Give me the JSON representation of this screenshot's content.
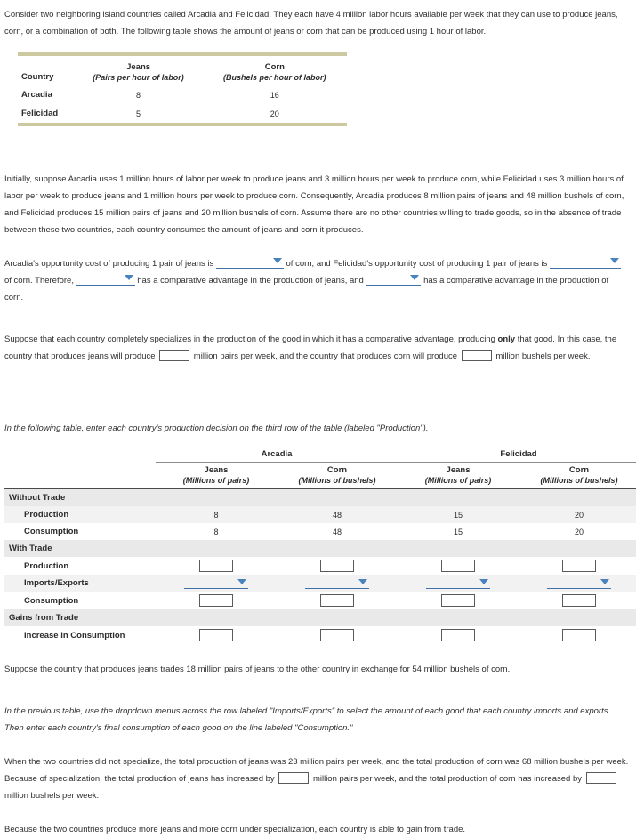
{
  "intro": {
    "paragraph": "Consider two neighboring island countries called Arcadia and Felicidad. They each have 4 million labor hours available per week that they can use to produce jeans, corn, or a combination of both. The following table shows the amount of jeans or corn that can be produced using 1 hour of labor."
  },
  "productivity_table": {
    "header_country": "Country",
    "goods": [
      {
        "name": "Jeans",
        "unit": "(Pairs per hour of labor)"
      },
      {
        "name": "Corn",
        "unit": "(Bushels per hour of labor)"
      }
    ],
    "rows": [
      {
        "country": "Arcadia",
        "jeans": "8",
        "corn": "16"
      },
      {
        "country": "Felicidad",
        "jeans": "5",
        "corn": "20"
      }
    ]
  },
  "initial": {
    "paragraph": "Initially, suppose Arcadia uses 1 million hours of labor per week to produce jeans and 3 million hours per week to produce corn, while Felicidad uses 3 million hours of labor per week to produce jeans and 1 million hours per week to produce corn. Consequently, Arcadia produces 8 million pairs of jeans and 48 million bushels of corn, and Felicidad produces 15 million pairs of jeans and 20 million bushels of corn. Assume there are no other countries willing to trade goods, so in the absence of trade between these two countries, each country consumes the amount of jeans and corn it produces."
  },
  "opportunity_cost": {
    "seg1": "Arcadia's opportunity cost of producing 1 pair of jeans is",
    "seg2": "of corn, and Felicidad's opportunity cost of producing 1 pair of jeans is",
    "seg3": "of corn. Therefore,",
    "seg4": "has a comparative advantage in the production of jeans, and",
    "seg5": "has a comparative advantage in the production of corn.",
    "dropdown_value": ""
  },
  "specialization": {
    "seg1": "Suppose that each country completely specializes in the production of the good in which it has a comparative advantage, producing",
    "emphasis": "only",
    "seg2": "that good. In this case, the country that produces jeans will produce",
    "seg3": "million pairs per week, and the country that produces corn will produce",
    "seg4": "million bushels per week.",
    "input_value": ""
  },
  "table_instruction": "In the following table, enter each country's production decision on the third row of the table (labeled \"Production\").",
  "trade_table": {
    "countries": [
      {
        "name": "Arcadia",
        "columns": [
          {
            "good": "Jeans",
            "unit": "(Millions of pairs)"
          },
          {
            "good": "Corn",
            "unit": "(Millions of bushels)"
          }
        ]
      },
      {
        "name": "Felicidad",
        "columns": [
          {
            "good": "Jeans",
            "unit": "(Millions of pairs)"
          },
          {
            "good": "Corn",
            "unit": "(Millions of bushels)"
          }
        ]
      }
    ],
    "sections": [
      {
        "title": "Without Trade",
        "rows": [
          {
            "label": "Production",
            "type": "value",
            "cells": [
              "8",
              "48",
              "15",
              "20"
            ]
          },
          {
            "label": "Consumption",
            "type": "value",
            "cells": [
              "8",
              "48",
              "15",
              "20"
            ]
          }
        ]
      },
      {
        "title": "With Trade",
        "rows": [
          {
            "label": "Production",
            "type": "input",
            "cells": [
              "",
              "",
              "",
              ""
            ]
          },
          {
            "label": "Imports/Exports",
            "type": "dropdown",
            "cells": [
              "",
              "",
              "",
              ""
            ]
          },
          {
            "label": "Consumption",
            "type": "input",
            "cells": [
              "",
              "",
              "",
              ""
            ]
          }
        ]
      },
      {
        "title": "Gains from Trade",
        "rows": [
          {
            "label": "Increase in Consumption",
            "type": "input",
            "cells": [
              "",
              "",
              "",
              ""
            ]
          }
        ]
      }
    ]
  },
  "trade_terms": {
    "paragraph": "Suppose the country that produces jeans trades 18 million pairs of jeans to the other country in exchange for 54 million bushels of corn."
  },
  "dropdown_instruction": "In the previous table, use the dropdown menus across the row labeled \"Imports/Exports\" to select the amount of each good that each country imports and exports. Then enter each country's final consumption of each good on the line labeled \"Consumption.\"",
  "totals": {
    "seg1": "When the two countries did not specialize, the total production of jeans was 23 million pairs per week, and the total production of corn was 68 million bushels per week. Because of specialization, the total production of jeans has increased by",
    "seg2": "million pairs per week, and the total production of corn has increased by",
    "seg3": "million bushels per week.",
    "input_value": ""
  },
  "conclusion": "Because the two countries produce more jeans and more corn under specialization, each country is able to gain from trade.",
  "colors": {
    "table_rule": "#ccc9a0",
    "dropdown_accent": "#4a82bd",
    "row_shade": "#e9e9e9"
  }
}
